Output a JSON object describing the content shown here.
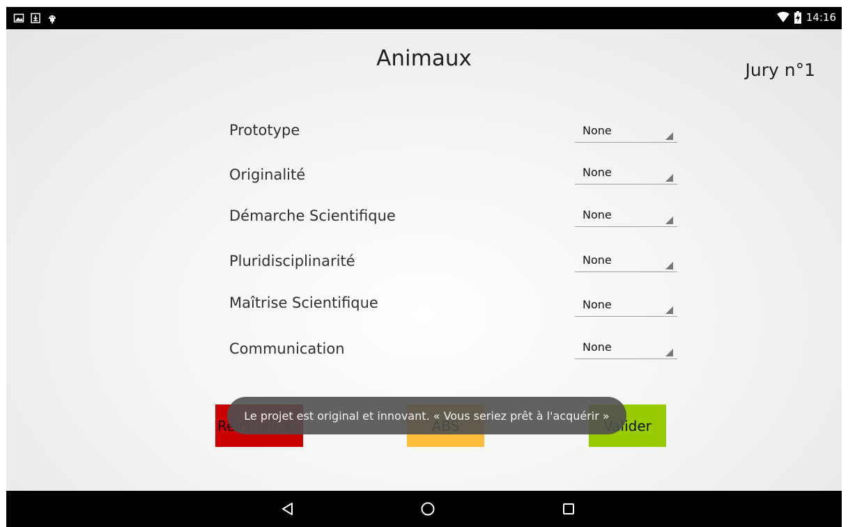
{
  "status_bar": {
    "left_icons": [
      "image-notification-icon",
      "download-notification-icon",
      "android-debug-icon"
    ],
    "right_icons": [
      "wifi-icon",
      "battery-charging-icon"
    ],
    "time": "14:16"
  },
  "header": {
    "title": "Animaux",
    "jury": "Jury n°1"
  },
  "criteria": [
    {
      "label": "Prototype",
      "value": "None"
    },
    {
      "label": "Originalité",
      "value": "None"
    },
    {
      "label": "Démarche Scientifique",
      "value": "None"
    },
    {
      "label": "Pluridisciplinarité",
      "value": "None"
    },
    {
      "label": "Maîtrise Scientifique",
      "value": "None"
    },
    {
      "label": "Communication",
      "value": "None"
    }
  ],
  "buttons": {
    "reset_label": "Réinitialiser",
    "abs_label": "ABS",
    "valider_label": "Valider"
  },
  "toast": {
    "text": "Le projet est original et innovant. « Vous seriez prêt à l'acquérir »"
  },
  "nav_bar": {
    "icons": [
      "back-icon",
      "home-icon",
      "recents-icon"
    ]
  },
  "colors": {
    "reset_bg": "#cc0000",
    "abs_bg": "#fbbd3a",
    "valider_bg": "#99cc00"
  }
}
